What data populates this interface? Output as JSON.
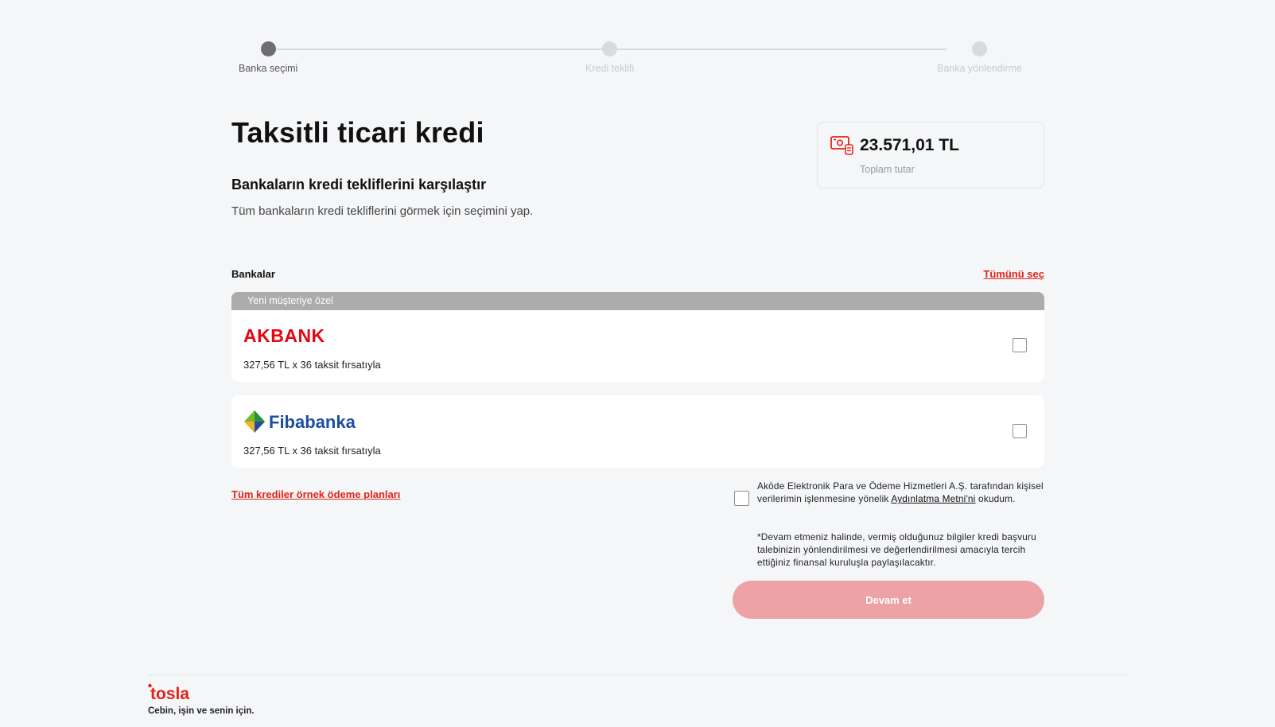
{
  "stepper": {
    "steps": [
      {
        "label": "Banka seçimi",
        "active": true
      },
      {
        "label": "Kredi teklifi",
        "active": false
      },
      {
        "label": "Banka yönlendirme",
        "active": false
      }
    ]
  },
  "header": {
    "title": "Taksitli ticari kredi",
    "subtitle": "Bankaların kredi tekliflerini karşılaştır",
    "description": "Tüm bankaların kredi tekliflerini görmek için seçimini yap."
  },
  "total": {
    "icon": "money-icon",
    "amount": "23.571,01 TL",
    "label": "Toplam tutar"
  },
  "banks": {
    "label": "Bankalar",
    "select_all": "Tümünü seç",
    "special_label": "Yeni müşteriye özel",
    "items": [
      {
        "name": "AKBANK",
        "offer": "327,56 TL x 36 taksit fırsatıyla",
        "checked": false
      },
      {
        "name": "Fibabanka",
        "offer": "327,56 TL x 36 taksit fırsatıyla",
        "checked": false
      }
    ]
  },
  "all_plans_link": "Tüm krediler örnek ödeme planları",
  "consent": {
    "text_before": "Aköde Elektronik Para ve Ödeme Hizmetleri A.Ş. tarafından kişisel verilerimin işlenmesine yönelik ",
    "link": "Aydınlatma Metni'ni",
    "text_after": " okudum.",
    "checked": false
  },
  "note": "*Devam etmeniz halinde, vermiş olduğunuz bilgiler kredi başvuru talebinizin yönlendirilmesi ve değerlendirilmesi amacıyla tercih ettiğiniz finansal kuruluşla paylaşılacaktır.",
  "continue_button": "Devam et",
  "colors": {
    "accent": "#e2231a",
    "button_disabled": "#eda3a6",
    "akbank_red": "#e30613",
    "fiba_blue": "#1e4ea1"
  },
  "footer": {
    "logo": "tosla",
    "tagline": "Cebin, işin ve senin için."
  }
}
